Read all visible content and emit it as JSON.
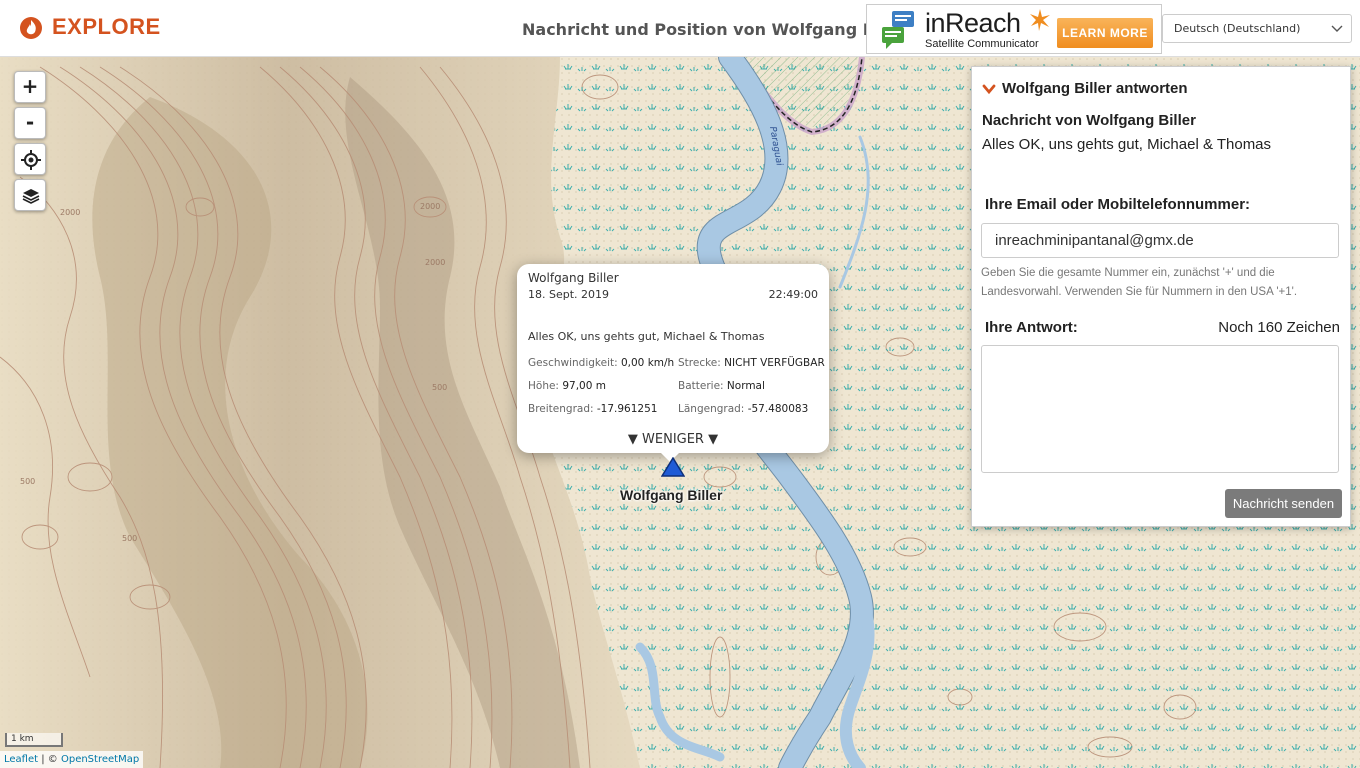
{
  "header": {
    "logo_text": "EXPLORE",
    "page_title": "Nachricht und Position von Wolfgang Biller",
    "ad": {
      "brand": "inReach",
      "subtitle": "Satellite Communicator",
      "cta": "LEARN MORE"
    },
    "language": "Deutsch (Deutschland)"
  },
  "map": {
    "zoom_in": "+",
    "zoom_out": "-",
    "scale": "1 km",
    "attribution_leaflet": "Leaflet",
    "attribution_sep": " | © ",
    "attribution_osm": "OpenStreetMap",
    "contour_labels": [
      "2000",
      "2000",
      "2000",
      "500",
      "500",
      "500"
    ],
    "river_label": "Paraguai",
    "marker_label": "Wolfgang Biller",
    "colors": {
      "terrain": "#efe6d2",
      "contour": "#b88e76",
      "river": "#a9c8e3",
      "marsh": "#2aa9a9",
      "marker": "#1f5bd6"
    }
  },
  "popup": {
    "name": "Wolfgang Biller",
    "date": "18. Sept. 2019",
    "time": "22:49:00",
    "message": "Alles OK, uns gehts gut, Michael & Thomas",
    "speed_label": "Geschwindigkeit:",
    "speed_value": "0,00 km/h",
    "route_label": "Strecke:",
    "route_value": "NICHT VERFÜGBAR",
    "altitude_label": "Höhe:",
    "altitude_value": "97,00 m",
    "battery_label": "Batterie:",
    "battery_value": "Normal",
    "lat_label": "Breitengrad:",
    "lat_value": "-17.961251",
    "lon_label": "Längengrad:",
    "lon_value": "-57.480083",
    "less_toggle": "▼ WENIGER ▼"
  },
  "reply_panel": {
    "heading": "Wolfgang Biller antworten",
    "message_heading": "Nachricht von Wolfgang Biller",
    "message_text": "Alles OK, uns gehts gut, Michael & Thomas",
    "contact_label": "Ihre Email oder Mobiltelefonnummer:",
    "contact_value": "inreachminipantanal@gmx.de",
    "contact_hint": "Geben Sie die gesamte Nummer ein, zunächst '+' und die Landesvorwahl. Verwenden Sie für Nummern in den USA '+1'.",
    "reply_label": "Ihre Antwort:",
    "chars_left": "Noch 160 Zeichen",
    "reply_text": "",
    "send_button": "Nachricht senden"
  }
}
